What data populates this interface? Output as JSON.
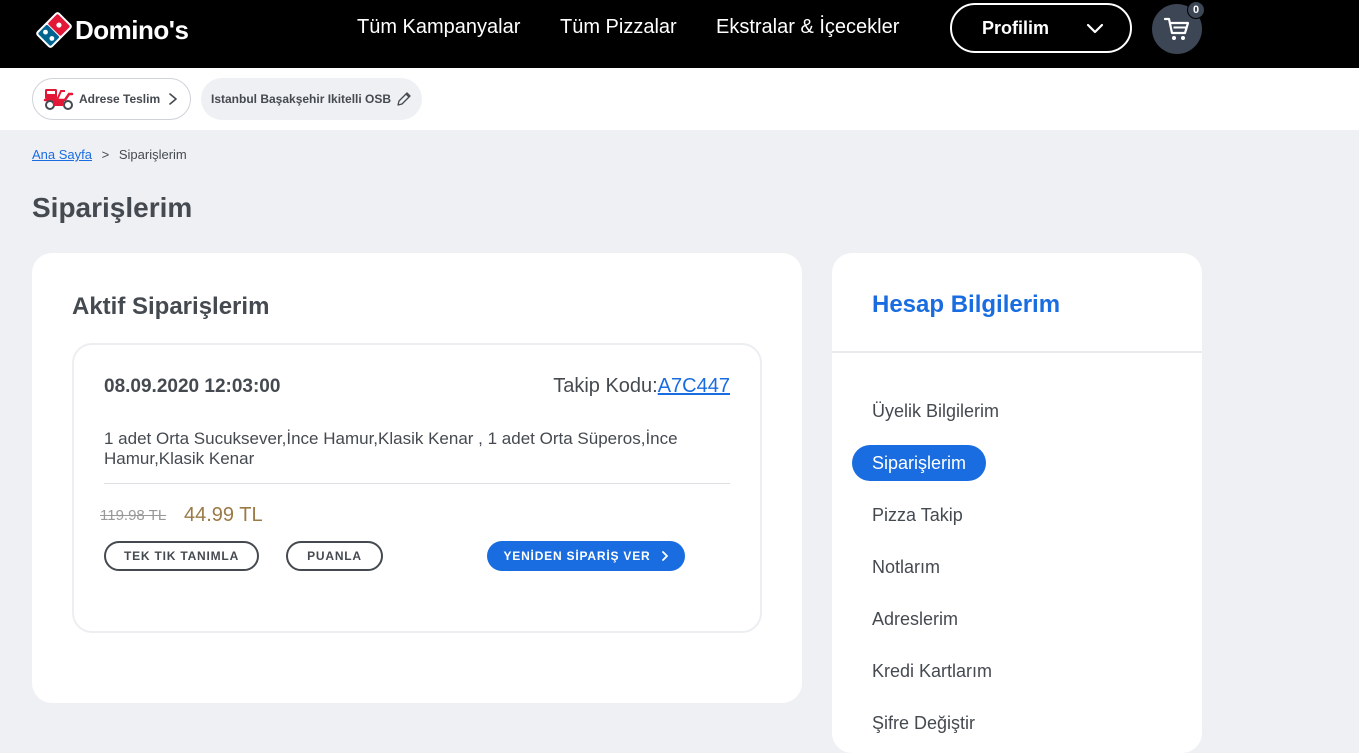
{
  "header": {
    "brand": "Domino's",
    "nav": [
      "Tüm Kampanyalar",
      "Tüm Pizzalar",
      "Ekstralar & İçecekler"
    ],
    "profile_label": "Profilim",
    "cart_count": "0"
  },
  "delivery": {
    "mode_label": "Adrese Teslim",
    "address": "Istanbul Başakşehir Ikitelli OSB"
  },
  "breadcrumb": {
    "home": "Ana Sayfa",
    "separator": ">",
    "current": "Siparişlerim"
  },
  "page_title": "Siparişlerim",
  "active_orders": {
    "title": "Aktif Siparişlerim",
    "order": {
      "date": "08.09.2020 12:03:00",
      "tracking_label": "Takip Kodu:",
      "tracking_code": "A7C447",
      "description": "1 adet Orta Sucuksever,İnce Hamur,Klasik Kenar , 1 adet Orta Süperos,İnce Hamur,Klasik Kenar",
      "old_price": "119.98 TL",
      "new_price": "44.99 TL",
      "buttons": {
        "one_click": "TEK TIK TANIMLA",
        "rate": "PUANLA",
        "reorder": "YENİDEN SİPARİŞ VER"
      }
    }
  },
  "sidebar": {
    "title": "Hesap Bilgilerim",
    "items": [
      {
        "label": "Üyelik Bilgilerim",
        "active": false
      },
      {
        "label": "Siparişlerim",
        "active": true
      },
      {
        "label": "Pizza Takip",
        "active": false
      },
      {
        "label": "Notlarım",
        "active": false
      },
      {
        "label": "Adreslerim",
        "active": false
      },
      {
        "label": "Kredi Kartlarım",
        "active": false
      },
      {
        "label": "Şifre Değiştir",
        "active": false
      }
    ]
  },
  "colors": {
    "accent": "#1a6de0",
    "header_bg": "#000000",
    "page_bg": "#eff0f4",
    "price": "#9a7a46"
  }
}
